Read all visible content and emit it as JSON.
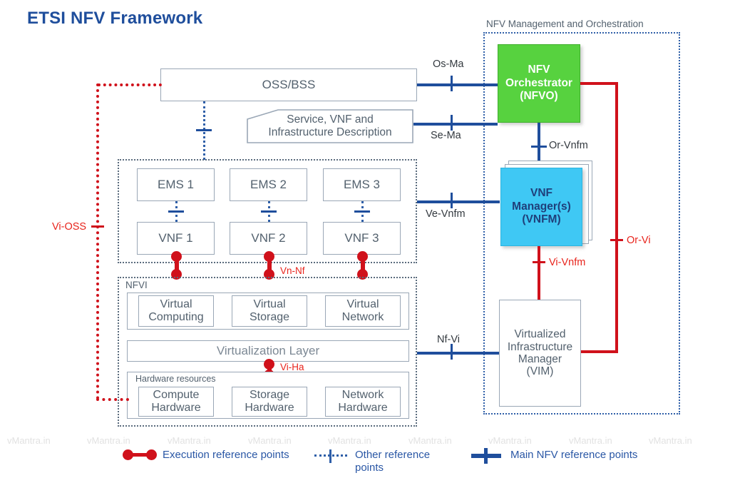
{
  "title": "ETSI NFV Framework",
  "containers": {
    "mano": {
      "label": "NFV Management and Orchestration"
    },
    "nfvi": {
      "label": "NFVI"
    },
    "hardware": {
      "label": "Hardware resources"
    }
  },
  "boxes": {
    "oss_bss": "OSS/BSS",
    "description": "Service, VNF and\nInfrastructure Description",
    "ems": [
      "EMS 1",
      "EMS 2",
      "EMS 3"
    ],
    "vnf": [
      "VNF 1",
      "VNF 2",
      "VNF 3"
    ],
    "virtual_resources": [
      "Virtual\nComputing",
      "Virtual\nStorage",
      "Virtual\nNetwork"
    ],
    "virtualization_layer": "Virtualization Layer",
    "hardware_resources": [
      "Compute\nHardware",
      "Storage\nHardware",
      "Network\nHardware"
    ],
    "nfvo": "NFV\nOrchestrator\n(NFVO)",
    "vnfm": "VNF\nManager(s)\n(VNFM)",
    "vim": "Virtualized\nInfrastructure\nManager\n(VIM)"
  },
  "reference_points": {
    "os_ma": "Os-Ma",
    "se_ma": "Se-Ma",
    "ve_vnfm": "Ve-Vnfm",
    "nf_vi": "Nf-Vi",
    "or_vnfm": "Or-Vnfm",
    "or_vi": "Or-Vi",
    "vi_vnfm": "Vi-Vnfm",
    "vi_ha": "Vi-Ha",
    "vn_nf": "Vn-Nf",
    "vi_oss": "Vi-OSS"
  },
  "legend": [
    {
      "marker": "execution-reference-marker",
      "label": "Execution reference points"
    },
    {
      "marker": "other-reference-marker",
      "label": "Other reference\npoints"
    },
    {
      "marker": "main-nfv-reference-marker",
      "label": "Main NFV reference points"
    }
  ],
  "watermark": {
    "text": "vMantra.in",
    "positions_x": [
      10,
      122,
      235,
      348,
      460,
      573,
      685,
      798,
      910
    ]
  },
  "colors": {
    "title": "#1F4E9C",
    "nfvo_fill": "#57D23F",
    "vnfm_fill": "#3FC8F4",
    "main_reference_blue": "#1F4E9C",
    "execution_reference_red": "#D0111B",
    "box_border_grey": "#9AA7B6",
    "box_text_grey": "#53616E",
    "legend_text": "#2A57A5"
  }
}
